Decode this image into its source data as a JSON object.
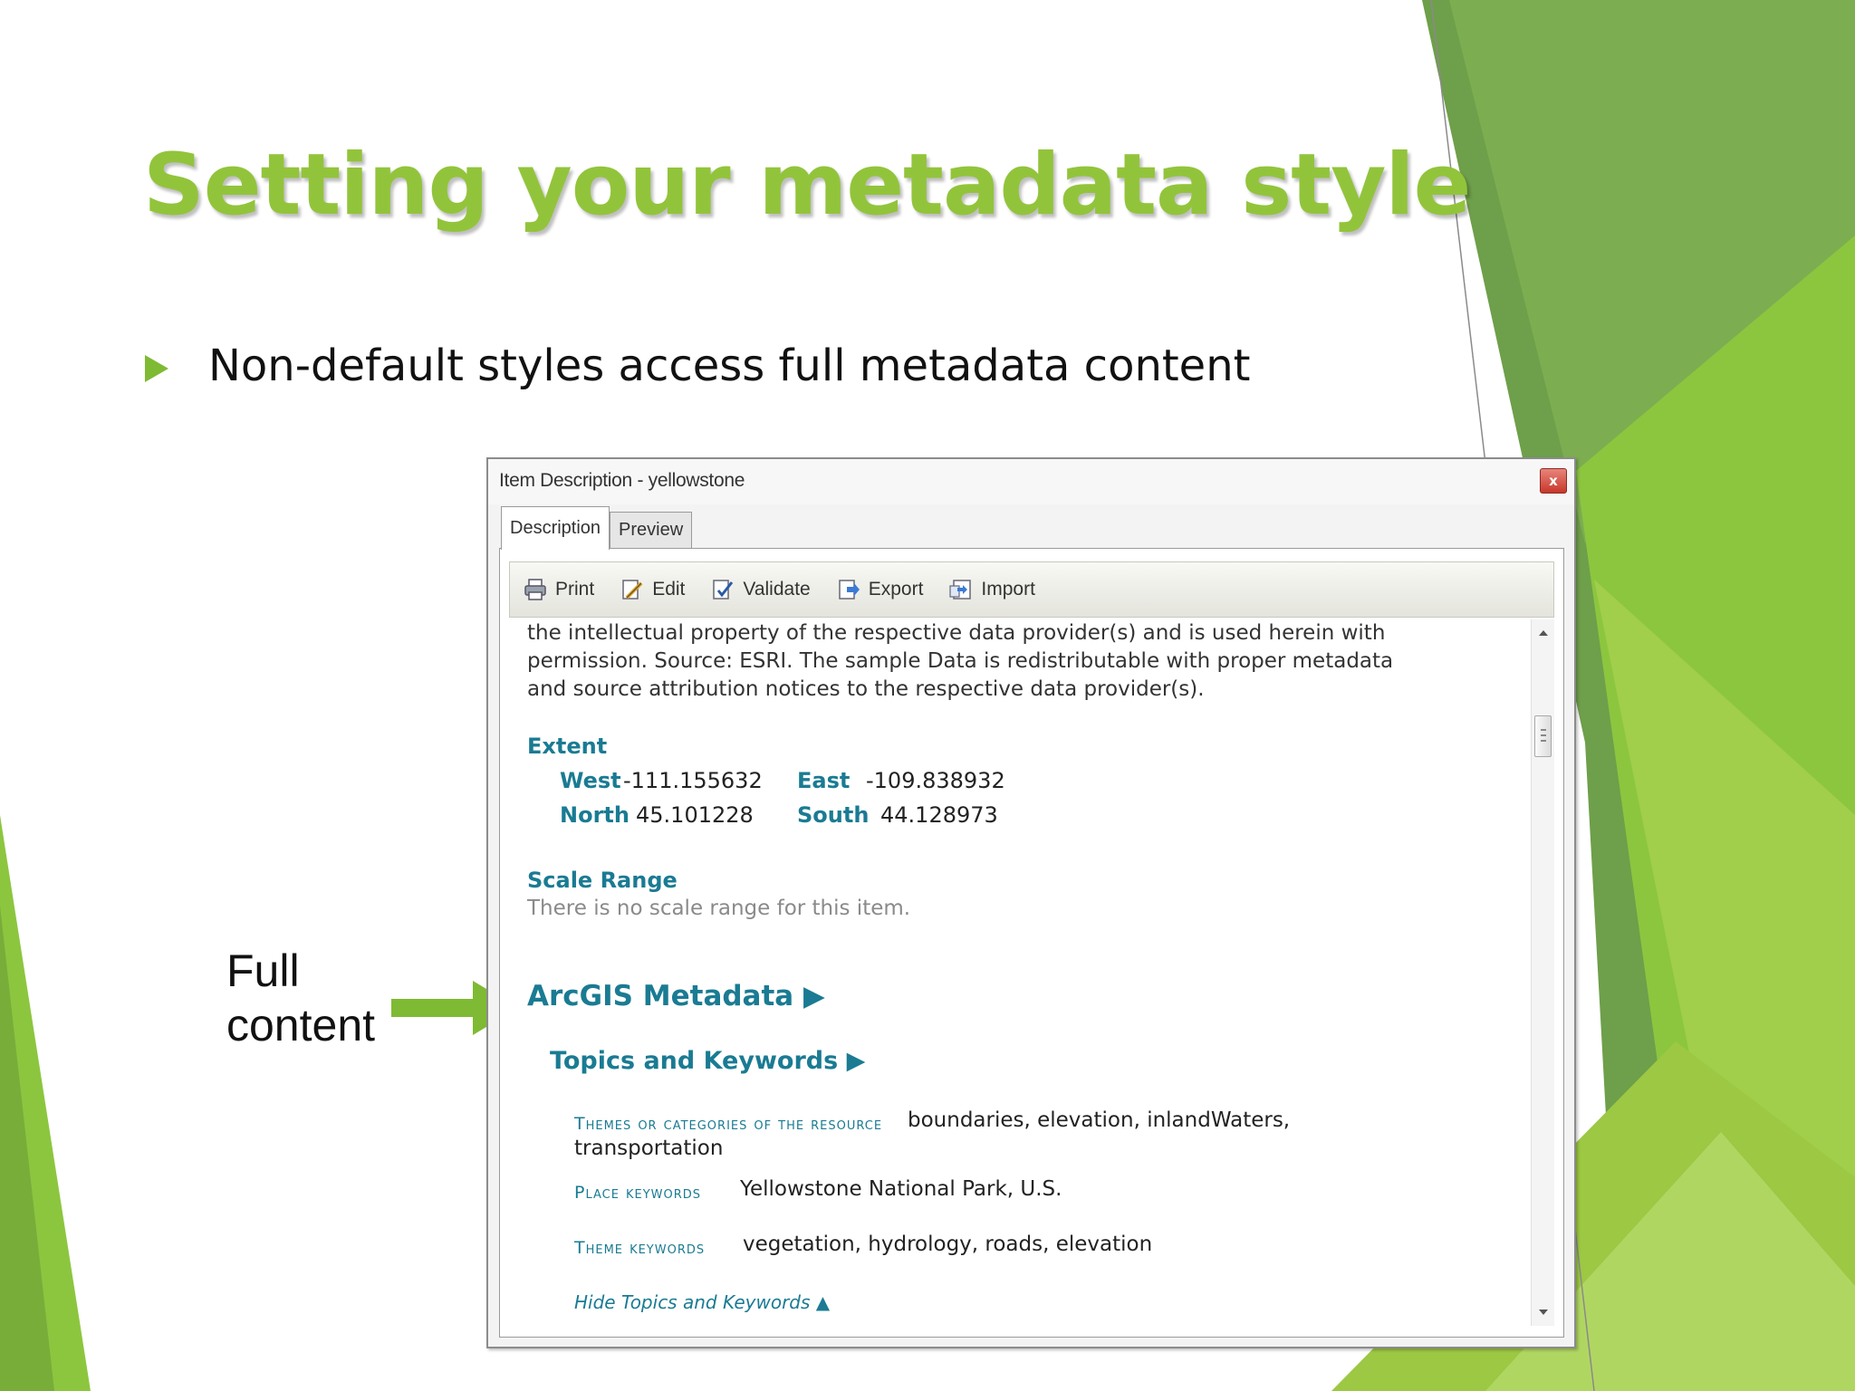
{
  "slide": {
    "title": "Setting your metadata style",
    "bullet": "Non-default styles access full metadata content",
    "callout": {
      "line1": "Full",
      "line2": "content"
    }
  },
  "colors": {
    "title_green": "#92c43b",
    "bullet_green": "#7fba34",
    "link_teal": "#1a7b93"
  },
  "window": {
    "title": "Item Description - yellowstone",
    "close_glyph": "x",
    "tabs": [
      {
        "label": "Description",
        "selected": true
      },
      {
        "label": "Preview",
        "selected": false
      }
    ],
    "toolbar": [
      {
        "label": "Print",
        "icon": "printer-icon"
      },
      {
        "label": "Edit",
        "icon": "edit-icon"
      },
      {
        "label": "Validate",
        "icon": "validate-icon"
      },
      {
        "label": "Export",
        "icon": "export-icon"
      },
      {
        "label": "Import",
        "icon": "import-icon"
      }
    ]
  },
  "content": {
    "intro_lines": [
      "the intellectual property of the respective data provider(s) and is used herein with",
      "permission. Source: ESRI. The sample Data is redistributable with proper metadata",
      "and source attribution notices to the respective data provider(s)."
    ],
    "extent": {
      "heading": "Extent",
      "west_label": "West",
      "west_value": "-111.155632",
      "east_label": "East",
      "east_value": "-109.838932",
      "north_label": "North",
      "north_value": "45.101228",
      "south_label": "South",
      "south_value": "44.128973"
    },
    "scale_range": {
      "heading": "Scale Range",
      "text": "There is no scale range for this item."
    },
    "arcgis_heading": "ArcGIS Metadata ▶",
    "topics_heading": "Topics and Keywords ▶",
    "keywords": [
      {
        "label": "Themes or categories of the resource",
        "value_line1": "boundaries, elevation, inlandWaters,",
        "value_line2": "transportation"
      },
      {
        "label": "Place keywords",
        "value_line1": "Yellowstone National Park, U.S."
      },
      {
        "label": "Theme keywords",
        "value_line1": "vegetation, hydrology, roads, elevation"
      }
    ],
    "hide_link": "Hide Topics and Keywords ▲"
  }
}
